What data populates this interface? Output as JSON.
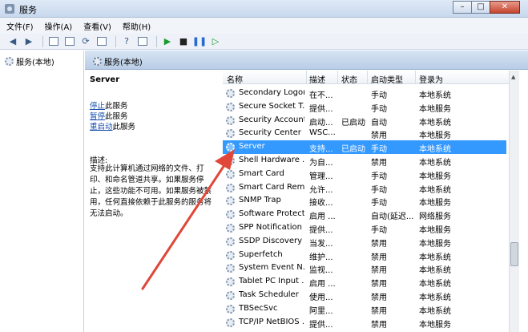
{
  "window": {
    "title": "服务"
  },
  "menu": [
    "文件(F)",
    "操作(A)",
    "查看(V)",
    "帮助(H)"
  ],
  "tree": {
    "root": "服务(本地)"
  },
  "header": {
    "title": "服务(本地)"
  },
  "details": {
    "service_name": "Server",
    "actions": [
      "停止",
      "暂停",
      "重启动"
    ],
    "action_suffix": "此服务",
    "desc_label": "描述:",
    "desc_text": "支持此计算机通过网络的文件、打印、和命名管道共享。如果服务停止，这些功能不可用。如果服务被禁用，任何直接依赖于此服务的服务将无法启动。"
  },
  "columns": [
    "名称",
    "描述",
    "状态",
    "启动类型",
    "登录为"
  ],
  "services": [
    [
      "Secondary Logon",
      "在不...",
      "",
      "手动",
      "本地系统"
    ],
    [
      "Secure Socket T...",
      "提供...",
      "",
      "手动",
      "本地服务"
    ],
    [
      "Security Account...",
      "启动...",
      "已启动",
      "自动",
      "本地系统"
    ],
    [
      "Security Center",
      "WSC...",
      "",
      "禁用",
      "本地服务"
    ],
    [
      "Server",
      "支持...",
      "已启动",
      "手动",
      "本地系统"
    ],
    [
      "Shell Hardware ...",
      "为自...",
      "",
      "禁用",
      "本地系统"
    ],
    [
      "Smart Card",
      "管理...",
      "",
      "手动",
      "本地服务"
    ],
    [
      "Smart Card Rem...",
      "允许...",
      "",
      "手动",
      "本地系统"
    ],
    [
      "SNMP Trap",
      "接收...",
      "",
      "手动",
      "本地服务"
    ],
    [
      "Software Protect...",
      "启用 ...",
      "",
      "自动(延迟...",
      "网络服务"
    ],
    [
      "SPP Notification ...",
      "提供...",
      "",
      "手动",
      "本地服务"
    ],
    [
      "SSDP Discovery",
      "当发...",
      "",
      "禁用",
      "本地服务"
    ],
    [
      "Superfetch",
      "维护...",
      "",
      "禁用",
      "本地系统"
    ],
    [
      "System Event N...",
      "监视...",
      "",
      "禁用",
      "本地系统"
    ],
    [
      "Tablet PC Input ...",
      "启用 ...",
      "",
      "禁用",
      "本地系统"
    ],
    [
      "Task Scheduler",
      "使用...",
      "",
      "禁用",
      "本地系统"
    ],
    [
      "TBSecSvc",
      "阿里...",
      "",
      "禁用",
      "本地系统"
    ],
    [
      "TCP/IP NetBIOS ...",
      "提供...",
      "",
      "禁用",
      "本地服务"
    ]
  ],
  "selected_service": "Server",
  "colors": {
    "selection": "#3399ff",
    "arrow": "#e0473a"
  }
}
